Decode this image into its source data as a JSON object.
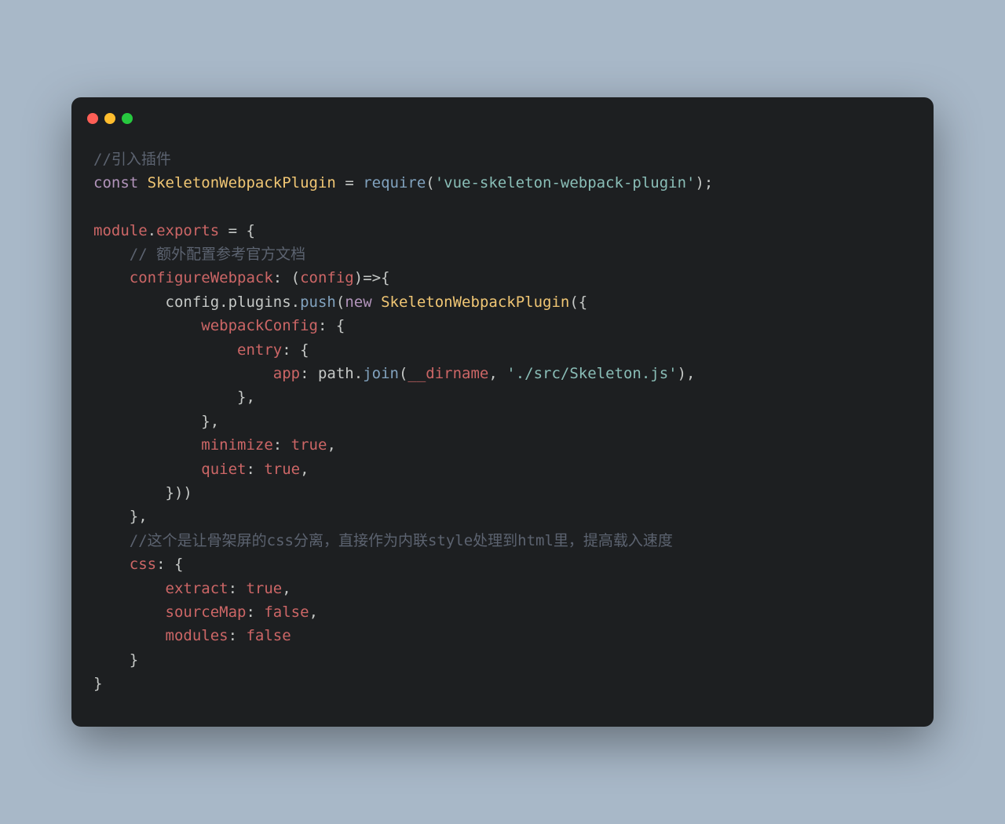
{
  "code": {
    "line1_comment": "//引入插件",
    "line2_const": "const",
    "line2_name": "SkeletonWebpackPlugin",
    "line2_eq": " = ",
    "line2_require": "require",
    "line2_open": "(",
    "line2_str": "'vue-skeleton-webpack-plugin'",
    "line2_close": ");",
    "line4_module": "module",
    "line4_dot": ".",
    "line4_exports": "exports",
    "line4_rest": " = {",
    "line5_comment": "    // 额外配置参考官方文档",
    "line6_prop": "    configureWebpack",
    "line6_colon": ": (",
    "line6_param": "config",
    "line6_arrow": ")=>{",
    "line7_pre": "        config.plugins.",
    "line7_push": "push",
    "line7_open": "(",
    "line7_new": "new",
    "line7_space": " ",
    "line7_class": "SkeletonWebpackPlugin",
    "line7_after": "({",
    "line8_prop": "            webpackConfig",
    "line8_rest": ": {",
    "line9_prop": "                entry",
    "line9_rest": ": {",
    "line10_prop": "                    app",
    "line10_colon": ": path.",
    "line10_join": "join",
    "line10_open": "(",
    "line10_dirname": "__dirname",
    "line10_comma": ", ",
    "line10_str": "'./src/Skeleton.js'",
    "line10_close": "),",
    "line11": "                },",
    "line12": "            },",
    "line13_prop": "            minimize",
    "line13_colon": ": ",
    "line13_val": "true",
    "line13_comma": ",",
    "line14_prop": "            quiet",
    "line14_colon": ": ",
    "line14_val": "true",
    "line14_comma": ",",
    "line15": "        }))",
    "line16": "    },",
    "line17_comment": "    //这个是让骨架屏的css分离，直接作为内联style处理到html里，提高载入速度",
    "line18_prop": "    css",
    "line18_rest": ": {",
    "line19_prop": "        extract",
    "line19_colon": ": ",
    "line19_val": "true",
    "line19_comma": ",",
    "line20_prop": "        sourceMap",
    "line20_colon": ": ",
    "line20_val": "false",
    "line20_comma": ",",
    "line21_prop": "        modules",
    "line21_colon": ": ",
    "line21_val": "false",
    "line22": "    }",
    "line23": "}"
  }
}
